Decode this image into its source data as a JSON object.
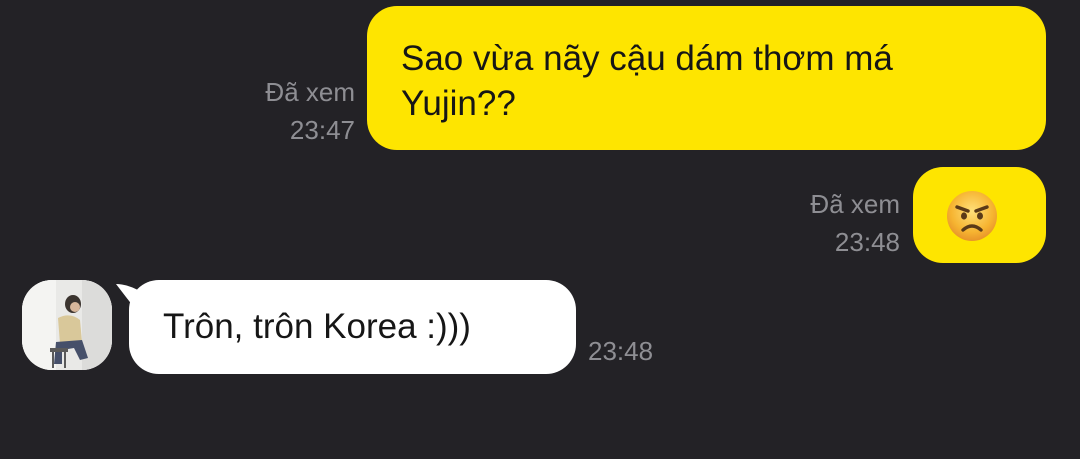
{
  "messages": [
    {
      "direction": "outgoing",
      "text_line1": "Sao vừa nãy cậu dám thơm má",
      "text_line2": "Yujin??",
      "status": "Đã xem",
      "time": "23:47"
    },
    {
      "direction": "outgoing",
      "emoji": "angry-face",
      "status": "Đã xem",
      "time": "23:48"
    },
    {
      "direction": "incoming",
      "text": "Trôn, trôn Korea :)))",
      "time": "23:48"
    }
  ],
  "colors": {
    "background": "#232226",
    "outgoing_bubble": "#fee500",
    "incoming_bubble": "#ffffff",
    "meta_text": "#8e8e93"
  }
}
